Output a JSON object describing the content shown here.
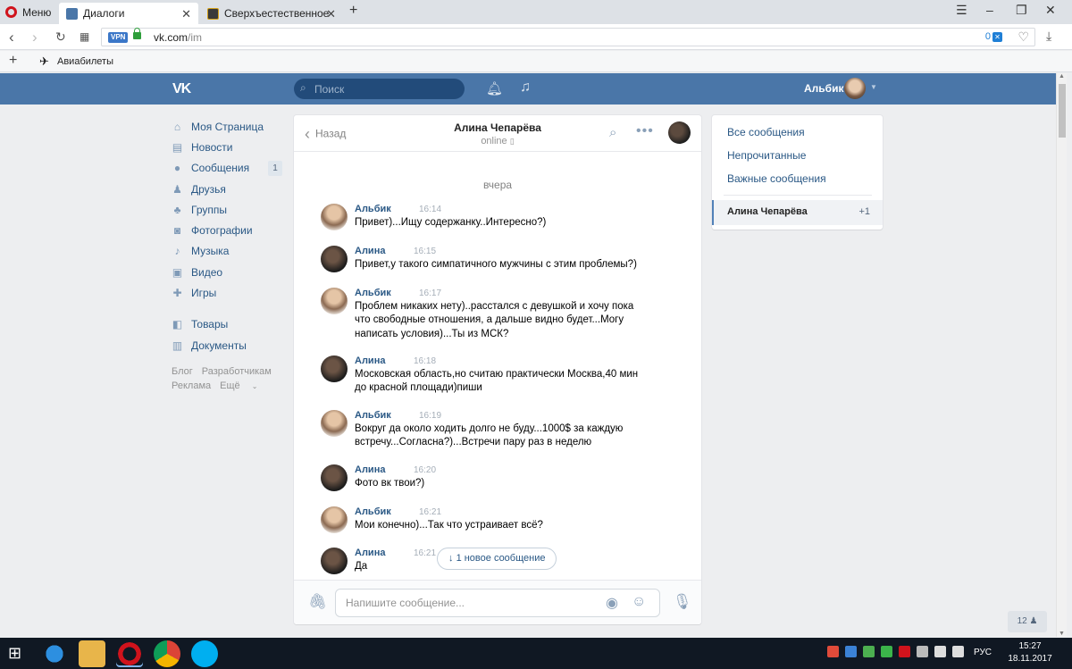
{
  "browser": {
    "menu_label": "Меню",
    "tabs": [
      {
        "title": "Диалоги",
        "favicon_color": "#4a76a8"
      },
      {
        "title": "Сверхъестественное - см",
        "favicon_color": "#2b2b2b"
      }
    ],
    "url_host": "vk.com",
    "url_path": "/im",
    "vpn_label": "VPN",
    "adblock_count": "0",
    "bookmark": "Авиабилеты"
  },
  "vk": {
    "logo": "VK",
    "search_placeholder": "Поиск",
    "user_name": "Альбик",
    "brand_color": "#4a76a8"
  },
  "left_nav": {
    "items": [
      {
        "label": "Моя Страница",
        "icon": "home-icon"
      },
      {
        "label": "Новости",
        "icon": "news-icon"
      },
      {
        "label": "Сообщения",
        "icon": "messages-icon",
        "count": "1"
      },
      {
        "label": "Друзья",
        "icon": "friends-icon"
      },
      {
        "label": "Группы",
        "icon": "groups-icon"
      },
      {
        "label": "Фотографии",
        "icon": "photos-icon"
      },
      {
        "label": "Музыка",
        "icon": "music-icon"
      },
      {
        "label": "Видео",
        "icon": "video-icon"
      },
      {
        "label": "Игры",
        "icon": "games-icon"
      }
    ],
    "items2": [
      {
        "label": "Товары",
        "icon": "goods-icon"
      },
      {
        "label": "Документы",
        "icon": "documents-icon"
      }
    ],
    "footer_row1": [
      "Блог",
      "Разработчикам"
    ],
    "footer_row2": [
      "Реклама",
      "Ещё"
    ]
  },
  "dialog": {
    "back_label": "Назад",
    "peer_name": "Алина Чепарёва",
    "peer_status": "online",
    "date_separator": "вчера",
    "messages": [
      {
        "author": "Альбик",
        "time": "16:14",
        "text": "Привет)...Ищу содержанку..Интересно?)"
      },
      {
        "author": "Алина",
        "time": "16:15",
        "text": "Привет,у такого симпатичного мужчины с этим проблемы?)"
      },
      {
        "author": "Альбик",
        "time": "16:17",
        "text": "Проблем никаких нету)..расстался с девушкой и хочу пока что свободные отношения, а дальше видно будет...Могу написать условия)...Ты из МСК?"
      },
      {
        "author": "Алина",
        "time": "16:18",
        "text": "Московская область,но считаю практически Москва,40 мин до красной площади)пиши"
      },
      {
        "author": "Альбик",
        "time": "16:19",
        "text": "Вокруг да около ходить долго не буду...1000$ за каждую встречу...Согласна?)...Встречи пару раз в неделю"
      },
      {
        "author": "Алина",
        "time": "16:20",
        "text": "Фото вк твои?)"
      },
      {
        "author": "Альбик",
        "time": "16:21",
        "text": "Мои конечно)...Так что устраивает всё?"
      },
      {
        "author": "Алина",
        "time": "16:21",
        "text": "Да"
      }
    ],
    "new_message_pill": "1 новое сообщение",
    "composer_placeholder": "Напишите сообщение..."
  },
  "filters": {
    "items": [
      "Все сообщения",
      "Непрочитанные",
      "Важные сообщения"
    ],
    "active_chat_name": "Алина Чепарёва",
    "active_chat_count": "+1"
  },
  "online_badge": "12",
  "taskbar": {
    "lang": "РУС",
    "time": "15:27",
    "date": "18.11.2017"
  }
}
